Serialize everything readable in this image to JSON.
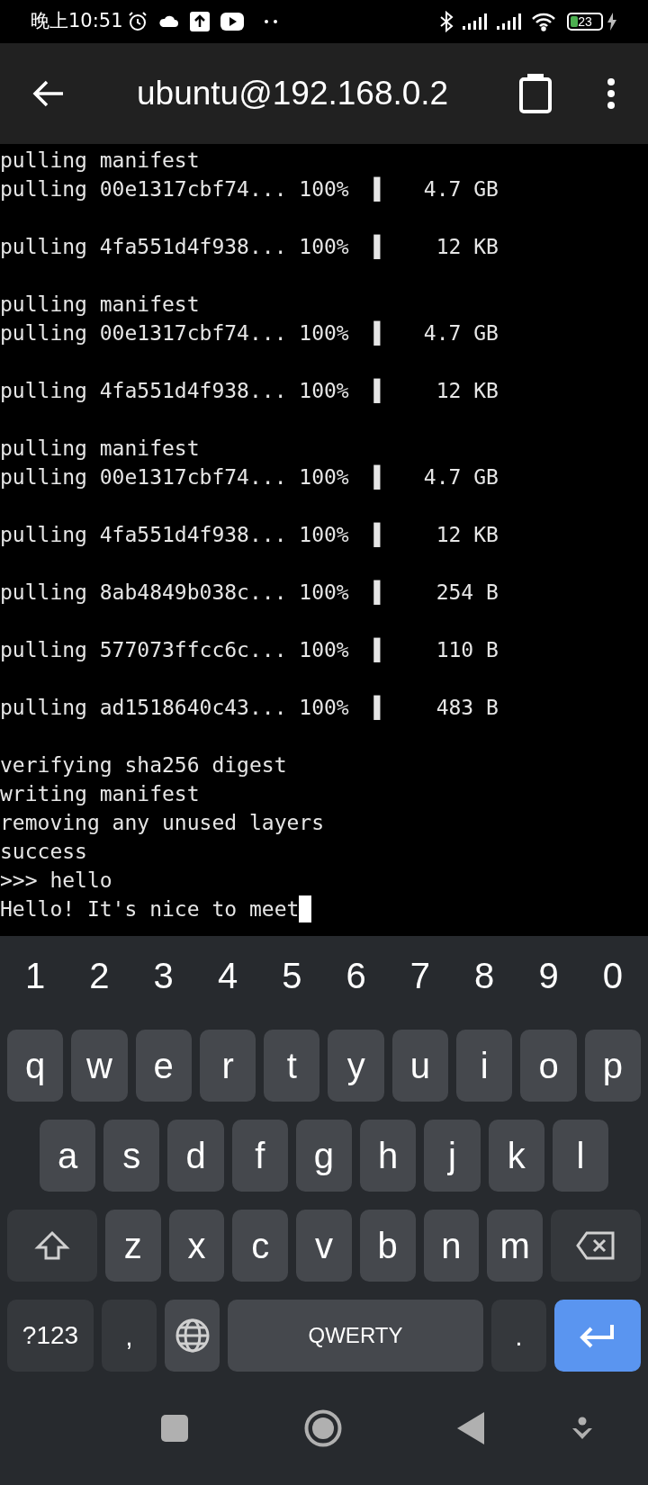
{
  "status_bar": {
    "time": "晚上10:51",
    "battery": "23"
  },
  "app_bar": {
    "title": "ubuntu@192.168.0.2"
  },
  "terminal": {
    "blocks": [
      [
        "pulling manifest",
        "pulling 00e1317cbf74... 100%  ▌   4.7 GB"
      ],
      [
        "pulling 4fa551d4f938... 100%  ▌    12 KB"
      ],
      [
        "pulling manifest",
        "pulling 00e1317cbf74... 100%  ▌   4.7 GB"
      ],
      [
        "pulling 4fa551d4f938... 100%  ▌    12 KB"
      ],
      [
        "pulling manifest",
        "pulling 00e1317cbf74... 100%  ▌   4.7 GB"
      ],
      [
        "pulling 4fa551d4f938... 100%  ▌    12 KB"
      ],
      [
        "pulling 8ab4849b038c... 100%  ▌    254 B"
      ],
      [
        "pulling 577073ffcc6c... 100%  ▌    110 B"
      ],
      [
        "pulling ad1518640c43... 100%  ▌    483 B"
      ],
      [
        "verifying sha256 digest",
        "writing manifest",
        "removing any unused layers",
        "success",
        ">>> hello",
        "Hello! It's nice to meet"
      ]
    ],
    "cursor": true
  },
  "keyboard": {
    "number_row": [
      {
        "kind": "digit",
        "label": "1"
      },
      {
        "kind": "digit",
        "label": "2"
      },
      {
        "kind": "digit",
        "label": "3"
      },
      {
        "kind": "digit",
        "label": "4"
      },
      {
        "kind": "digit",
        "label": "5"
      },
      {
        "kind": "digit",
        "label": "6"
      },
      {
        "kind": "digit",
        "label": "7"
      },
      {
        "kind": "digit",
        "label": "8"
      },
      {
        "kind": "digit",
        "label": "9"
      },
      {
        "kind": "digit",
        "label": "0"
      }
    ],
    "top_letter_row": [
      {
        "kind": "letter",
        "label": "q"
      },
      {
        "kind": "letter",
        "label": "w"
      },
      {
        "kind": "letter",
        "label": "e"
      },
      {
        "kind": "letter",
        "label": "r"
      },
      {
        "kind": "letter",
        "label": "t"
      },
      {
        "kind": "letter",
        "label": "y"
      },
      {
        "kind": "letter",
        "label": "u"
      },
      {
        "kind": "letter",
        "label": "i"
      },
      {
        "kind": "letter",
        "label": "o"
      },
      {
        "kind": "letter",
        "label": "p"
      }
    ],
    "home_row": [
      {
        "kind": "letter",
        "label": "a"
      },
      {
        "kind": "letter",
        "label": "s"
      },
      {
        "kind": "letter",
        "label": "d"
      },
      {
        "kind": "letter",
        "label": "f"
      },
      {
        "kind": "letter",
        "label": "g"
      },
      {
        "kind": "letter",
        "label": "h"
      },
      {
        "kind": "letter",
        "label": "j"
      },
      {
        "kind": "letter",
        "label": "k"
      },
      {
        "kind": "letter",
        "label": "l"
      }
    ],
    "bottom_letter_row": [
      {
        "kind": "shift"
      },
      {
        "kind": "letter",
        "label": "z"
      },
      {
        "kind": "letter",
        "label": "x"
      },
      {
        "kind": "letter",
        "label": "c"
      },
      {
        "kind": "letter",
        "label": "v"
      },
      {
        "kind": "letter",
        "label": "b"
      },
      {
        "kind": "letter",
        "label": "n"
      },
      {
        "kind": "letter",
        "label": "m"
      },
      {
        "kind": "backspace"
      }
    ],
    "function_row": [
      {
        "kind": "symbols",
        "label": "?123"
      },
      {
        "kind": "punct",
        "label": ","
      },
      {
        "kind": "globe"
      },
      {
        "kind": "space",
        "label": "QWERTY"
      },
      {
        "kind": "punct",
        "label": "."
      },
      {
        "kind": "enter"
      }
    ]
  }
}
